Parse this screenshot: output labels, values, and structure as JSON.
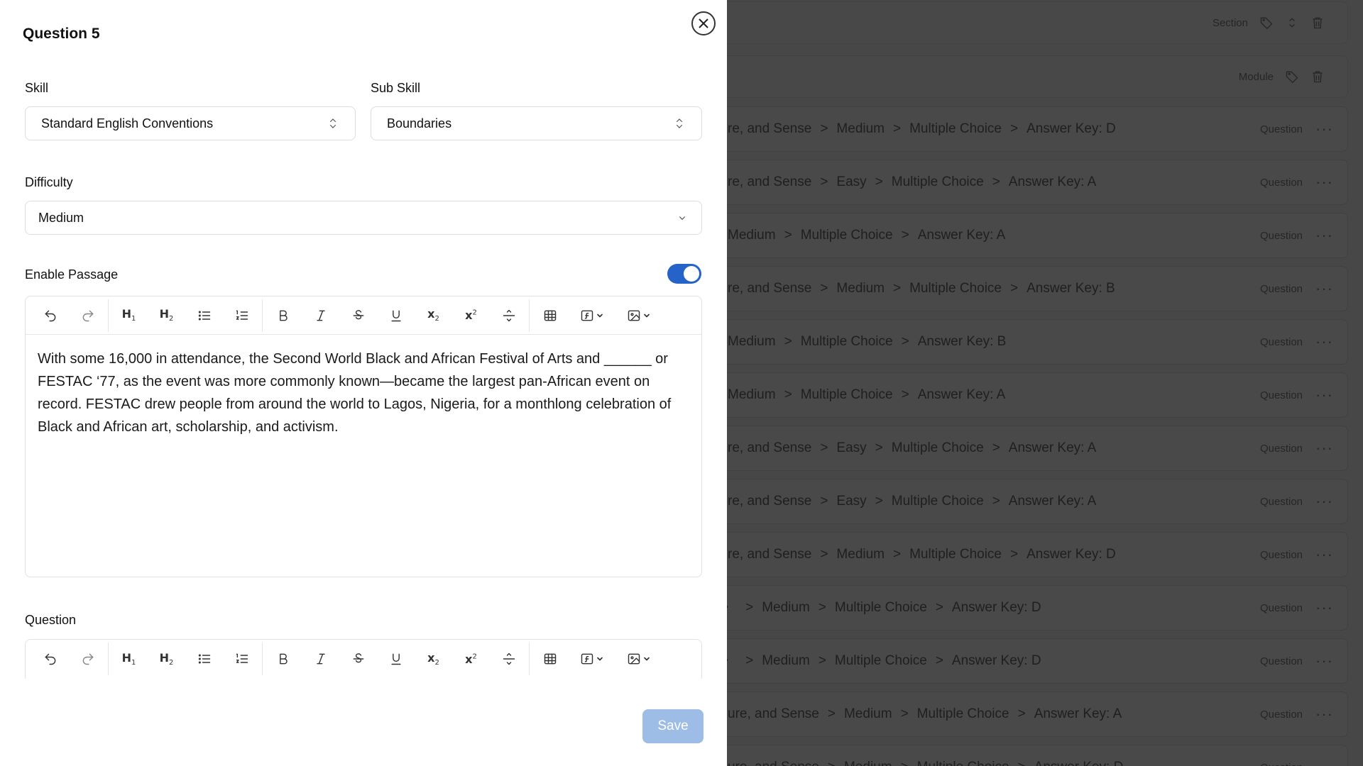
{
  "modal": {
    "title": "Question 5",
    "skill_label": "Skill",
    "skill_value": "Standard English Conventions",
    "sub_skill_label": "Sub Skill",
    "sub_skill_value": "Boundaries",
    "difficulty_label": "Difficulty",
    "difficulty_value": "Medium",
    "passage_label": "Enable Passage",
    "passage_enabled": true,
    "passage_text": "With some 16,000 in attendance, the Second World Black and African Festival of Arts and ______ or FESTAC ‘77, as the event was more commonly known—became the largest pan-African event on record. FESTAC drew people from around the world to Lagos, Nigeria, for a monthlong celebration of Black and African art, scholarship, and activism.",
    "question_label": "Question",
    "save_label": "Save"
  },
  "toolbar_icons": [
    "undo-icon",
    "redo-icon",
    "heading-1-icon",
    "heading-2-icon",
    "bullet-list-icon",
    "ordered-list-icon",
    "bold-icon",
    "italic-icon",
    "strikethrough-icon",
    "underline-icon",
    "subscript-icon",
    "superscript-icon",
    "horizontal-rule-icon",
    "table-icon",
    "formula-icon",
    "image-icon"
  ],
  "background": {
    "section_label": "Section",
    "module_label": "Module",
    "row_tag": "Question",
    "rows": [
      [
        "re, and Sense",
        "Medium",
        "Multiple Choice",
        "Answer Key: D"
      ],
      [
        "re, and Sense",
        "Easy",
        "Multiple Choice",
        "Answer Key: A"
      ],
      [
        "Medium",
        "Multiple Choice",
        "Answer Key: A"
      ],
      [
        "re, and Sense",
        "Medium",
        "Multiple Choice",
        "Answer Key: B"
      ],
      [
        "Medium",
        "Multiple Choice",
        "Answer Key: B"
      ],
      [
        "Medium",
        "Multiple Choice",
        "Answer Key: A"
      ],
      [
        "re, and Sense",
        "Easy",
        "Multiple Choice",
        "Answer Key: A"
      ],
      [
        "re, and Sense",
        "Easy",
        "Multiple Choice",
        "Answer Key: A"
      ],
      [
        "re, and Sense",
        "Medium",
        "Multiple Choice",
        "Answer Key: D"
      ],
      [
        "",
        "Medium",
        "Multiple Choice",
        "Answer Key: D"
      ],
      [
        "",
        "Medium",
        "Multiple Choice",
        "Answer Key: D"
      ],
      [
        "ure, and Sense",
        "Medium",
        "Multiple Choice",
        "Answer Key: A"
      ],
      [
        "ure, and Sense",
        "Medium",
        "Multiple Choice",
        "Answer Key: D"
      ]
    ]
  },
  "colors": {
    "accent": "#2563c9",
    "save_disabled": "#9ebde6",
    "overlay": "#474747"
  }
}
